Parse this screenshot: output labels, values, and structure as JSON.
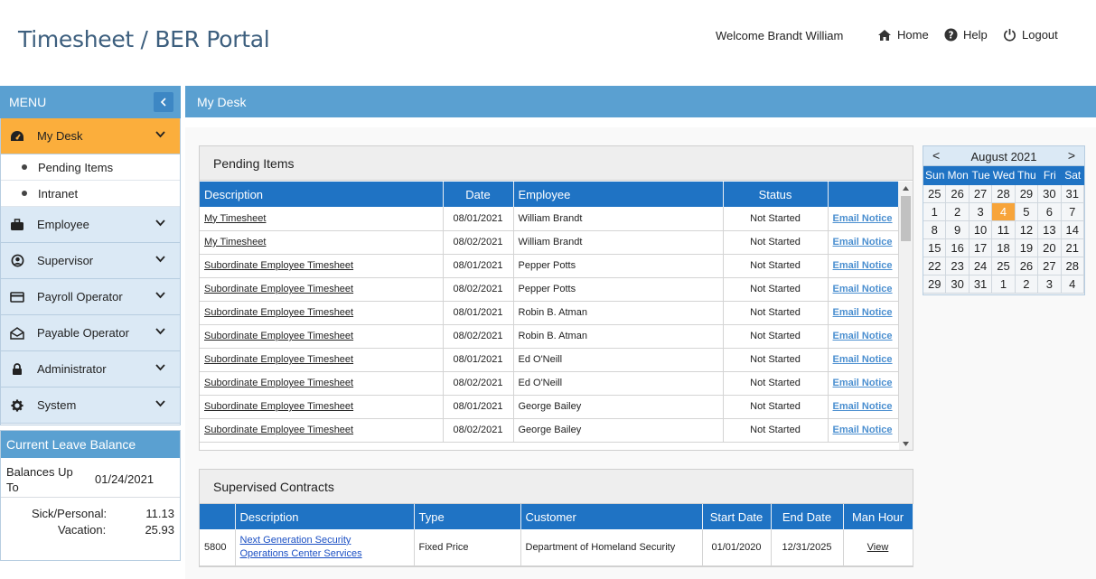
{
  "app": {
    "title": "Timesheet / BER Portal",
    "welcome": "Welcome Brandt William"
  },
  "nav": {
    "home": "Home",
    "help": "Help",
    "logout": "Logout"
  },
  "menu": {
    "header": "MENU",
    "items": [
      {
        "label": "My Desk",
        "icon": "dashboard-icon",
        "active": true
      },
      {
        "label": "Employee",
        "icon": "briefcase-icon"
      },
      {
        "label": "Supervisor",
        "icon": "user-circle-icon"
      },
      {
        "label": "Payroll Operator",
        "icon": "credit-card-icon"
      },
      {
        "label": "Payable Operator",
        "icon": "envelope-open-icon"
      },
      {
        "label": "Administrator",
        "icon": "lock-icon"
      },
      {
        "label": "System",
        "icon": "gear-icon"
      }
    ],
    "subitems": [
      {
        "label": "Pending Items"
      },
      {
        "label": "Intranet"
      }
    ]
  },
  "leave": {
    "title": "Current Leave Balance",
    "balances_label": "Balances Up To",
    "balances_date": "01/24/2021",
    "sick_label": "Sick/Personal:",
    "sick_value": "11.13",
    "vacation_label": "Vacation:",
    "vacation_value": "25.93"
  },
  "content": {
    "title": "My Desk"
  },
  "pending": {
    "title": "Pending Items",
    "columns": [
      "Description",
      "Date",
      "Employee",
      "Status",
      ""
    ],
    "rows": [
      {
        "desc": "My Timesheet",
        "date": "08/01/2021",
        "employee": "William Brandt",
        "status": "Not Started",
        "action": "Email Notice"
      },
      {
        "desc": "My Timesheet",
        "date": "08/02/2021",
        "employee": "William Brandt",
        "status": "Not Started",
        "action": "Email Notice"
      },
      {
        "desc": "Subordinate Employee Timesheet",
        "date": "08/01/2021",
        "employee": "Pepper Potts",
        "status": "Not Started",
        "action": "Email Notice"
      },
      {
        "desc": "Subordinate Employee Timesheet",
        "date": "08/02/2021",
        "employee": "Pepper Potts",
        "status": "Not Started",
        "action": "Email Notice"
      },
      {
        "desc": "Subordinate Employee Timesheet",
        "date": "08/01/2021",
        "employee": "Robin B. Atman",
        "status": "Not Started",
        "action": "Email Notice"
      },
      {
        "desc": "Subordinate Employee Timesheet",
        "date": "08/02/2021",
        "employee": "Robin B. Atman",
        "status": "Not Started",
        "action": "Email Notice"
      },
      {
        "desc": "Subordinate Employee Timesheet",
        "date": "08/01/2021",
        "employee": "Ed O'Neill",
        "status": "Not Started",
        "action": "Email Notice"
      },
      {
        "desc": "Subordinate Employee Timesheet",
        "date": "08/02/2021",
        "employee": "Ed O'Neill",
        "status": "Not Started",
        "action": "Email Notice"
      },
      {
        "desc": "Subordinate Employee Timesheet",
        "date": "08/01/2021",
        "employee": "George Bailey",
        "status": "Not Started",
        "action": "Email Notice"
      },
      {
        "desc": "Subordinate Employee Timesheet",
        "date": "08/02/2021",
        "employee": "George Bailey",
        "status": "Not Started",
        "action": "Email Notice"
      }
    ]
  },
  "contracts": {
    "title": "Supervised Contracts",
    "columns": [
      "",
      "Description",
      "Type",
      "Customer",
      "Start Date",
      "End Date",
      "Man Hour"
    ],
    "rows": [
      {
        "id": "5800",
        "desc_line1": "Next Generation Security",
        "desc_line2": "Operations Center Services",
        "type": "Fixed Price",
        "customer": "Department of Homeland Security",
        "start": "01/01/2020",
        "end": "12/31/2025",
        "man_hour": "View"
      }
    ]
  },
  "calendar": {
    "month": "August 2021",
    "prev": "<",
    "next": ">",
    "dows": [
      "Sun",
      "Mon",
      "Tue",
      "Wed",
      "Thu",
      "Fri",
      "Sat"
    ],
    "days": [
      "25",
      "26",
      "27",
      "28",
      "29",
      "30",
      "31",
      "1",
      "2",
      "3",
      "4",
      "5",
      "6",
      "7",
      "8",
      "9",
      "10",
      "11",
      "12",
      "13",
      "14",
      "15",
      "16",
      "17",
      "18",
      "19",
      "20",
      "21",
      "22",
      "23",
      "24",
      "25",
      "26",
      "27",
      "28",
      "29",
      "30",
      "31",
      "1",
      "2",
      "3",
      "4"
    ],
    "today_index": 10
  },
  "colors": {
    "accent_blue": "#5aa0d1",
    "table_header": "#1f73c4",
    "active_orange": "#fbae3c",
    "link_blue": "#4b8fd0"
  }
}
